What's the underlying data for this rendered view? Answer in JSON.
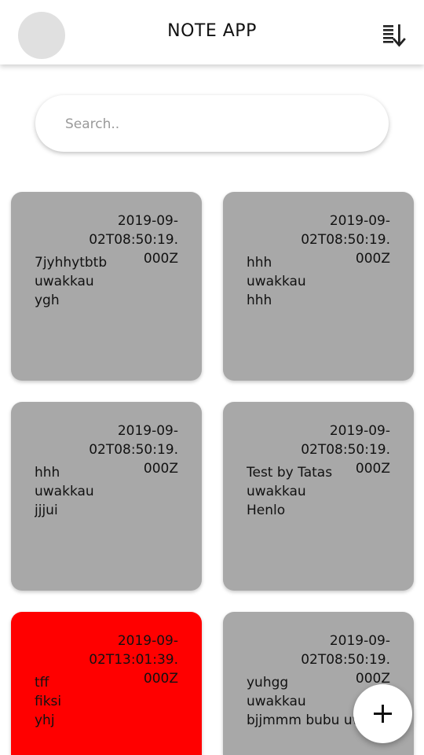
{
  "header": {
    "title": "NOTE APP",
    "avatar_icon": "avatar-placeholder",
    "sort_icon": "sort-descending-icon"
  },
  "search": {
    "placeholder": "Search..",
    "value": ""
  },
  "notes": [
    {
      "date_line1": "2019-09-02T08:50:19.",
      "date_line2": "000Z",
      "lines": [
        "7jyhhytbtb",
        "uwakkau",
        "ygh"
      ],
      "color": "#a8a8a8"
    },
    {
      "date_line1": "2019-09-02T08:50:19.",
      "date_line2": "000Z",
      "lines": [
        "hhh",
        "uwakkau",
        "hhh"
      ],
      "color": "#a8a8a8"
    },
    {
      "date_line1": "2019-09-02T08:50:19.",
      "date_line2": "000Z",
      "lines": [
        "hhh",
        "uwakkau",
        "jjjui"
      ],
      "color": "#a8a8a8"
    },
    {
      "date_line1": "2019-09-02T08:50:19.",
      "date_line2": "000Z",
      "lines": [
        "Test by Tatas",
        "uwakkau",
        "Henlo"
      ],
      "color": "#a8a8a8"
    },
    {
      "date_line1": "2019-09-02T13:01:39.",
      "date_line2": "000Z",
      "lines": [
        "tff",
        "fiksi",
        "yhj"
      ],
      "color": "#ff0000"
    },
    {
      "date_line1": "2019-09-02T08:50:19.",
      "date_line2": "000Z",
      "lines": [
        "yuhgg",
        "uwakkau",
        "bjjmmm bubu uwak"
      ],
      "color": "#a8a8a8"
    }
  ],
  "fab": {
    "label": "+",
    "icon": "plus-icon"
  },
  "colors": {
    "note_default": "#a8a8a8",
    "note_highlight": "#ff0000",
    "background": "#ffffff"
  }
}
